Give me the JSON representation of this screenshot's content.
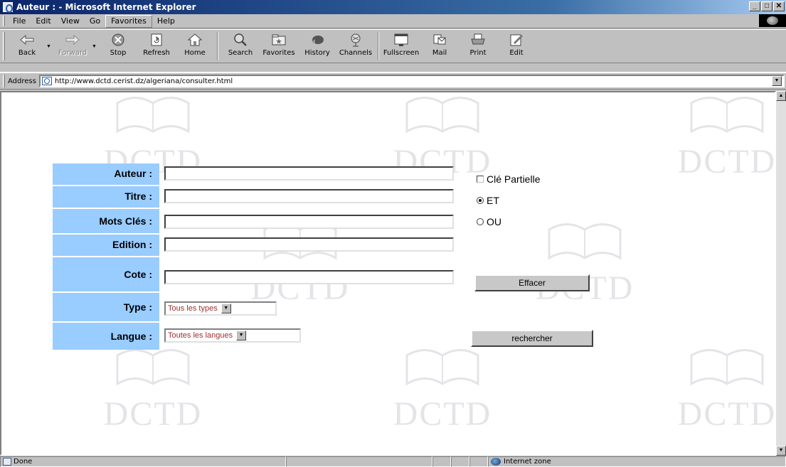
{
  "window": {
    "title": "Auteur : - Microsoft Internet Explorer",
    "minimize": "_",
    "maximize": "□",
    "close": "✕"
  },
  "menu": [
    "File",
    "Edit",
    "View",
    "Go",
    "Favorites",
    "Help"
  ],
  "toolbar": {
    "buttons": [
      {
        "label": "Back",
        "icon": "back-arrow-icon"
      },
      {
        "label": "Forward",
        "icon": "forward-arrow-icon"
      },
      {
        "label": "Stop",
        "icon": "stop-icon"
      },
      {
        "label": "Refresh",
        "icon": "refresh-icon"
      },
      {
        "label": "Home",
        "icon": "home-icon"
      },
      {
        "label": "Search",
        "icon": "search-icon"
      },
      {
        "label": "Favorites",
        "icon": "favorites-icon"
      },
      {
        "label": "History",
        "icon": "history-icon"
      },
      {
        "label": "Channels",
        "icon": "channels-icon"
      },
      {
        "label": "Fullscreen",
        "icon": "fullscreen-icon"
      },
      {
        "label": "Mail",
        "icon": "mail-icon"
      },
      {
        "label": "Print",
        "icon": "print-icon"
      },
      {
        "label": "Edit",
        "icon": "edit-icon"
      }
    ]
  },
  "address": {
    "label": "Address",
    "url": "http://www.dctd.cerist.dz/algeriana/consulter.html"
  },
  "watermark": {
    "text": "DCTD"
  },
  "form": {
    "labels": {
      "auteur": "Auteur :",
      "titre": "Titre :",
      "mots_cles": "Mots Clés :",
      "edition": "Edition :",
      "cote": "Cote :",
      "type": "Type :",
      "langue": "Langue :"
    },
    "values": {
      "auteur": "",
      "titre": "",
      "mots_cles": "",
      "edition": "",
      "cote": ""
    },
    "type_selected": "Tous les types",
    "langue_selected": "Toutes les langues",
    "cle_partielle": "Clé Partielle",
    "et": "ET",
    "ou": "OU",
    "effacer": "Effacer",
    "rechercher": "rechercher"
  },
  "status": {
    "text": "Done",
    "zone": "Internet zone"
  }
}
